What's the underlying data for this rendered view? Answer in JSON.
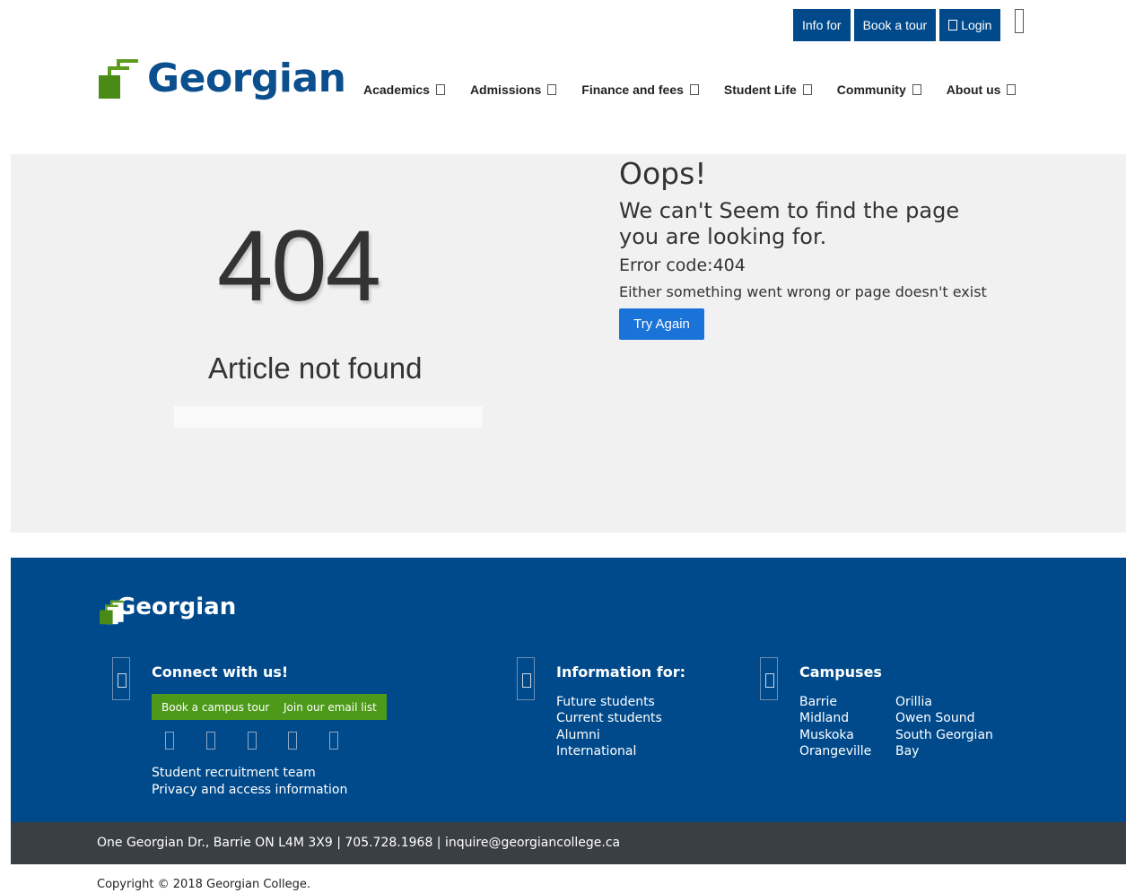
{
  "utility": {
    "info_for": "Info for",
    "book_tour": "Book a tour",
    "login": "Login"
  },
  "header": {
    "logo_text": "Georgian",
    "nav": [
      {
        "label": "Academics"
      },
      {
        "label": "Admissions"
      },
      {
        "label": "Finance and fees"
      },
      {
        "label": "Student Life"
      },
      {
        "label": "Community"
      },
      {
        "label": "About us"
      }
    ]
  },
  "error": {
    "big_code": "404",
    "article": "Article not found",
    "oops": "Oops!",
    "message": "We can't Seem to find the page you are looking for.",
    "code_line": "Error code:404",
    "detail": "Either something went wrong or page doesn't exist",
    "try_again": "Try Again"
  },
  "footer": {
    "logo_text": "Georgian",
    "connect": {
      "heading": "Connect with us!",
      "book_tour": "Book a campus tour",
      "email_list": "Join our email list",
      "links": [
        "Student recruitment team",
        "Privacy and access information"
      ]
    },
    "info": {
      "heading": "Information for:",
      "links": [
        "Future students",
        "Current students",
        "Alumni",
        "International"
      ]
    },
    "campuses": {
      "heading": "Campuses",
      "col1": [
        "Barrie",
        "Midland",
        "Muskoka",
        "Orangeville"
      ],
      "col2": [
        "Orillia",
        "Owen Sound",
        "South Georgian",
        "Bay"
      ]
    },
    "address": "One Georgian Dr., Barrie ON L4M 3X9 | 705.728.1968 | inquire@georgiancollege.ca",
    "copyright": "Copyright © 2018 Georgian College."
  },
  "colors": {
    "brand_blue": "#004a8c",
    "brand_green": "#4d9a1a",
    "button_blue": "#1a73d9"
  }
}
